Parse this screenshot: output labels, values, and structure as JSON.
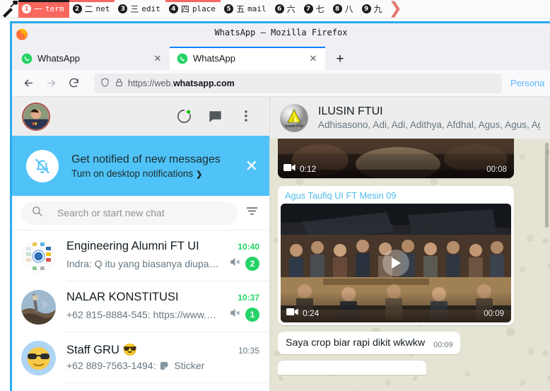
{
  "taskbar": {
    "launcher_icon": "tools-icon",
    "tags": [
      {
        "num": "1",
        "cn": "一",
        "name": "term",
        "active": true
      },
      {
        "num": "2",
        "cn": "二",
        "name": "net",
        "active": false
      },
      {
        "num": "3",
        "cn": "三",
        "name": "edit",
        "active": false
      },
      {
        "num": "4",
        "cn": "四",
        "name": "place",
        "active": false
      },
      {
        "num": "5",
        "cn": "五",
        "name": "mail",
        "active": false
      },
      {
        "num": "6",
        "cn": "六",
        "name": "",
        "active": false
      },
      {
        "num": "7",
        "cn": "七",
        "name": "",
        "active": false
      },
      {
        "num": "8",
        "cn": "八",
        "name": "",
        "active": false
      },
      {
        "num": "9",
        "cn": "九",
        "name": "",
        "active": false
      }
    ],
    "layout_arrow": "❯"
  },
  "browser": {
    "window_title": "WhatsApp – Mozilla Firefox",
    "tabs": [
      {
        "title": "WhatsApp",
        "active": false,
        "close": "✕",
        "favicon": "whatsapp-icon"
      },
      {
        "title": "WhatsApp",
        "active": true,
        "close": "✕",
        "favicon": "whatsapp-icon"
      }
    ],
    "new_tab_label": "+",
    "nav": {
      "back": "←",
      "forward": "→",
      "reload": "⟳"
    },
    "urlbar": {
      "shield_icon": "shield-icon",
      "lock_icon": "lock-icon",
      "url_prefix": "https://web.",
      "url_domain": "whatsapp.com"
    },
    "container_label": "Persona"
  },
  "whatsapp": {
    "header": {
      "profile_avatar": "user-avatar",
      "status_icon": "status-circle-icon",
      "new_chat_icon": "new-chat-icon",
      "menu_icon": "menu-dots-icon"
    },
    "notification_banner": {
      "icon": "bell-muted-icon",
      "title": "Get notified of new messages",
      "subtitle": "Turn on desktop notifications",
      "chevron": "❯",
      "close": "✕"
    },
    "search": {
      "icon": "search-icon",
      "placeholder": "Search or start new chat",
      "filter_icon": "filter-icon"
    },
    "chats": [
      {
        "avatar": "engineering-alumni-logo",
        "name": "Engineering  Alumni FT UI",
        "time": "10:40",
        "time_unread": true,
        "message": "Indra: Q itu yang biasanya diupa…",
        "muted": true,
        "badge": "2"
      },
      {
        "avatar": "nalar-konstitusi-photo",
        "name": "NALAR KONSTITUSI",
        "time": "10:37",
        "time_unread": true,
        "message": "+62 815-8884-545: https://www.…",
        "muted": true,
        "badge": "1"
      },
      {
        "avatar": "sunglasses-emoji",
        "name": "Staff GRU 😎",
        "time": "10:35",
        "time_unread": false,
        "message": "+62 889-7563-1494: ",
        "message_extra": "Sticker",
        "sticker_icon": "sticker-icon",
        "muted": false,
        "badge": ""
      }
    ],
    "conversation": {
      "avatar": "ilusin-ftui-logo",
      "title": "ILUSIN FTUI",
      "members": "Adhisasono, Adi, Adi, Adithya, Afdhal, Agus, Agus, Agus",
      "messages": [
        {
          "type": "video",
          "duration": "0:12",
          "time": "00:08",
          "video_icon": "video-camera-icon"
        },
        {
          "type": "video",
          "sender": "Agus Taufiq UI FT Mesin 09",
          "duration": "0:24",
          "time": "00:09",
          "video_icon": "video-camera-icon",
          "play_icon": "play-icon"
        },
        {
          "type": "text",
          "text": "Saya crop biar rapi dikit wkwkw",
          "time": "00:09"
        }
      ]
    }
  },
  "colors": {
    "accent_blue": "#4fc3f7",
    "whatsapp_green": "#25d366",
    "taskbar_active": "#f9685f",
    "sender_blue": "#53bdeb",
    "chat_bg": "#e4e3d4"
  }
}
